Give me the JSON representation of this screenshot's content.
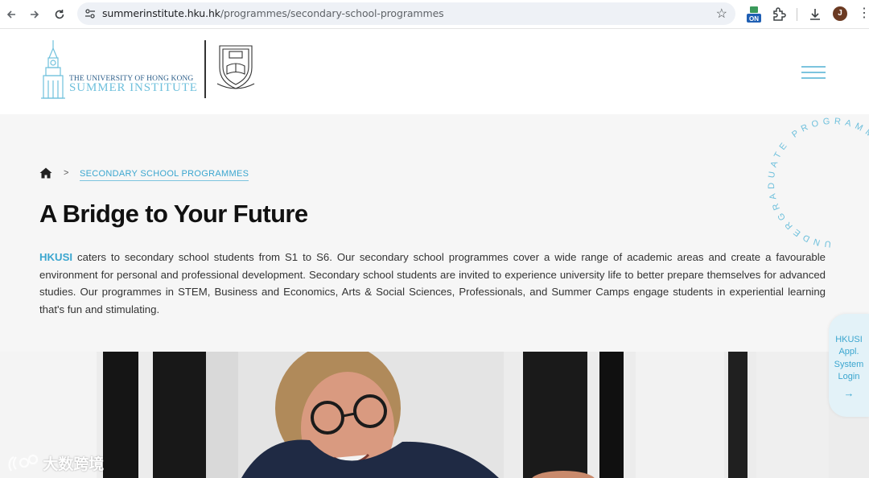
{
  "browser": {
    "url_host": "summerinstitute.hku.hk",
    "url_path": "/programmes/secondary-school-programmes",
    "extension_badge": "ON",
    "profile_initial": "J",
    "icons": [
      "back-icon",
      "forward-icon",
      "reload-icon",
      "site-settings-icon",
      "bookmark-star-icon",
      "extension-icon",
      "puzzle-icon",
      "download-icon",
      "menu-kebab-icon"
    ]
  },
  "header": {
    "logo_line1": "THE UNIVERSITY OF HONG KONG",
    "logo_line2": "SUMMER INSTITUTE",
    "menu_icon": "hamburger-icon"
  },
  "hero": {
    "breadcrumb_current": "SECONDARY SCHOOL PROGRAMMES",
    "breadcrumb_separator": ">",
    "title": "A Bridge to Your Future",
    "intro_brand": "HKUSI",
    "intro_rest": " caters to secondary school students from S1 to S6. Our secondary school programmes cover a wide range of academic areas and create a favourable environment for personal and professional development. Secondary school students are invited to experience university life to better prepare themselves for advanced studies. Our programmes in STEM, Business and Economics, Arts & Social Sciences, Professionals, and Summer Camps engage students in experiential learning that's fun and stimulating.",
    "circle_text": "UNDERGRADUATE PROGRAMMES"
  },
  "side_tab": {
    "label": "HKUSI Appl. System Login",
    "arrow": "→"
  },
  "watermark": {
    "text": "大数跨境"
  },
  "colors": {
    "accent": "#3ba6cf",
    "accent_light": "#7cc4de",
    "hero_bg": "#f6f6f6",
    "title": "#111111"
  }
}
